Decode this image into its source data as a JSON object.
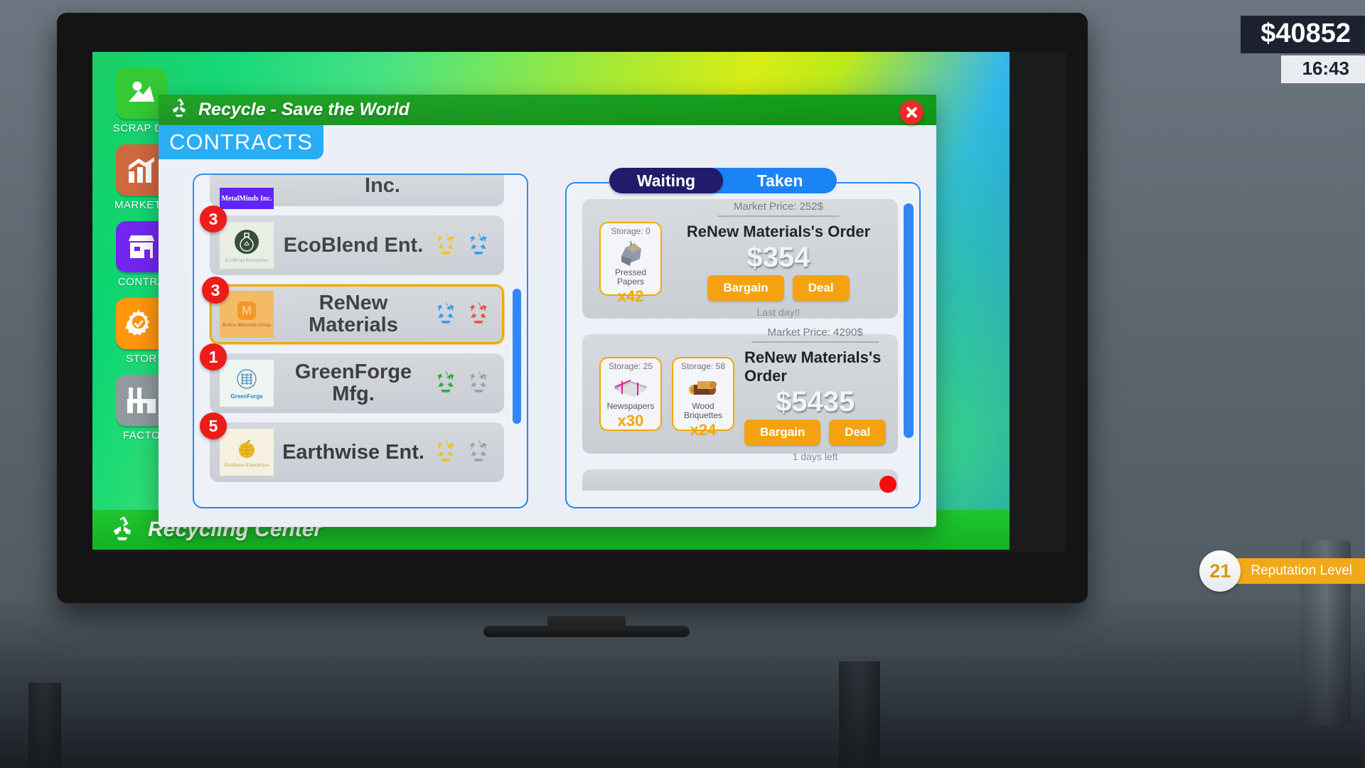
{
  "hud": {
    "money": "$40852",
    "time": "16:43",
    "reputation_value": "21",
    "reputation_label": "Reputation Level"
  },
  "sidebar": {
    "items": [
      {
        "label": "SCRAP DE",
        "icon": "map-pin-icon",
        "color": "#20c520"
      },
      {
        "label": "MARKETP",
        "icon": "bar-chart-icon",
        "color": "#cc5b2e"
      },
      {
        "label": "CONTRA",
        "icon": "shop-icon",
        "color": "#6a18f0"
      },
      {
        "label": "STOR",
        "icon": "gear-check-icon",
        "color": "#ff9100"
      },
      {
        "label": "FACTO",
        "icon": "factory-icon",
        "color": "#8e979c"
      }
    ]
  },
  "bottom_bar": {
    "title": "Recycling Center",
    "icon": "recycle-icon"
  },
  "modal": {
    "title": "Recycle  - Save the World",
    "title_icon": "recycle-icon",
    "close_icon": "close-icon",
    "tab_label": "CONTRACTS"
  },
  "companies": [
    {
      "name": "Inc.",
      "logo_text": "MetalMinds Inc.",
      "badge": "",
      "selected": false,
      "partial": true,
      "icons": []
    },
    {
      "name": "EcoBlend Ent.",
      "logo_text": "EcoBlend Enterprises",
      "badge": "3",
      "selected": false,
      "partial": false,
      "icons": [
        {
          "name": "recycle-icon",
          "color": "#f2c01e"
        },
        {
          "name": "recycle-icon",
          "color": "#2f9bf0"
        }
      ]
    },
    {
      "name": "ReNew Materials",
      "logo_text": "ReNew Materials Group",
      "badge": "3",
      "selected": true,
      "partial": false,
      "icons": [
        {
          "name": "recycle-icon",
          "color": "#2f9bf0"
        },
        {
          "name": "recycle-icon",
          "color": "#e0553a"
        }
      ]
    },
    {
      "name": "GreenForge Mfg.",
      "logo_text": "GreenForge",
      "badge": "1",
      "selected": false,
      "partial": false,
      "icons": [
        {
          "name": "recycle-icon",
          "color": "#2fa83a"
        },
        {
          "name": "recycle-icon",
          "color": "#9aa0a6"
        }
      ]
    },
    {
      "name": "Earthwise Ent.",
      "logo_text": "Earthwise Enterprises",
      "badge": "5",
      "selected": false,
      "partial": false,
      "icons": [
        {
          "name": "recycle-icon",
          "color": "#f2c01e"
        },
        {
          "name": "recycle-icon",
          "color": "#9aa0a6"
        }
      ]
    }
  ],
  "order_tabs": [
    {
      "label": "Waiting",
      "active": true
    },
    {
      "label": "Taken",
      "active": false
    }
  ],
  "orders": [
    {
      "market_price": "Market Price: 252$",
      "title": "ReNew Materials's Order",
      "price": "$354",
      "bargain_label": "Bargain",
      "deal_label": "Deal",
      "footer": "Last day!!",
      "items": [
        {
          "storage": "Storage: 0",
          "name": "Pressed Papers",
          "qty": "x42",
          "art": "pressed-papers-icon"
        }
      ]
    },
    {
      "market_price": "Market Price: 4290$",
      "title": "ReNew Materials's Order",
      "price": "$5435",
      "bargain_label": "Bargain",
      "deal_label": "Deal",
      "footer": "1 days left",
      "items": [
        {
          "storage": "Storage: 25",
          "name": "Newspapers",
          "qty": "x30",
          "art": "newspapers-icon"
        },
        {
          "storage": "Storage: 58",
          "name": "Wood Briquettes",
          "qty": "x24",
          "art": "wood-briquettes-icon"
        }
      ]
    }
  ],
  "colors": {
    "accent_blue": "#2488f0",
    "accent_orange": "#f5a210",
    "badge_red": "#ee1b1b",
    "selected_border": "#f2a800",
    "title_green": "#0d8c14"
  }
}
